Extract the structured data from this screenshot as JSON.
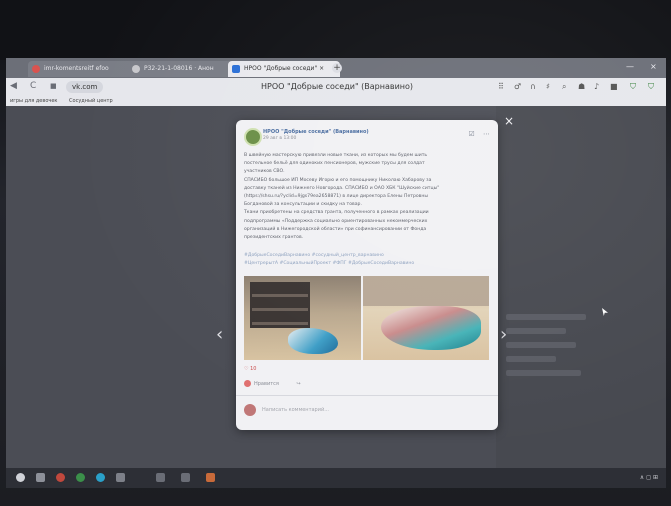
{
  "browser": {
    "tabs": [
      {
        "label": "imr-komentsreitf efoo",
        "active": false
      },
      {
        "label": "P32-21-1-08016 · Анон",
        "active": false
      },
      {
        "label": "НРОО \"Добрые соседи\" ×",
        "active": true
      }
    ],
    "new_tab": "+",
    "window_controls": [
      "—",
      "×"
    ],
    "nav": {
      "back": "◀",
      "forward": "▶",
      "reload": "C"
    },
    "url": "vk.com",
    "page_title": "НРОО \"Добрые соседи\" (Варнавино)",
    "extensions": [
      "⠿",
      "♂",
      "∩",
      "♯",
      "⌕",
      "☗",
      "♪",
      "■"
    ],
    "shield_icons": [
      "⛉",
      "⛉"
    ],
    "bookmarks": [
      "игры для девочек",
      "Сосудный центр"
    ]
  },
  "viewer": {
    "close": "×",
    "prev": "‹",
    "next": "›"
  },
  "post": {
    "author": "НРОО \"Добрые соседи\" (Варнавино)",
    "time": "29 авг в 13:00",
    "body_lines": [
      "В швейную мастерскую привезли новые ткани, из которых мы будем шить",
      "постельное бельё для одиноких пенсионеров, мужские трусы для солдат",
      "участников СВО.",
      "СПАСИБО большое ИП Мосеву Игорю и его помощнику Николаю Хабарову за",
      "доставку тканей из Нижнего Новгорода. СПАСИБО и ОАО ХБК \"Шуйские ситцы\"",
      "(https://shsu.ru/?yclid=9jgs79ea2658871) в лице директора Елены Петровны",
      "Богдановой за консультации и скидку на товар.",
      "Ткани приобретены на средства гранта, полученного в рамках реализации",
      "подпрограммы «Поддержка социально ориентированных некоммерческих",
      "организаций в Нижегородской области» при софинансировании от Фонда",
      "президентских грантов."
    ],
    "tags": [
      "#ДобрыеСоседиВарнавино #сосудный_центр_варнавино",
      "#ЦентрерытА #СоциальныйПроект #ФПГ #ДобрыеСоседиВарнавино"
    ],
    "likes_count": "♡ 10",
    "action_label": "Нравится",
    "comment_placeholder": "Написать комментарий..."
  },
  "taskbar": {
    "tray": "∧ ◻ ⊞"
  },
  "colors": {
    "accent_link": "#4a6da0",
    "like": "#c94c4c",
    "vk_blue": "#2b6fd6"
  }
}
